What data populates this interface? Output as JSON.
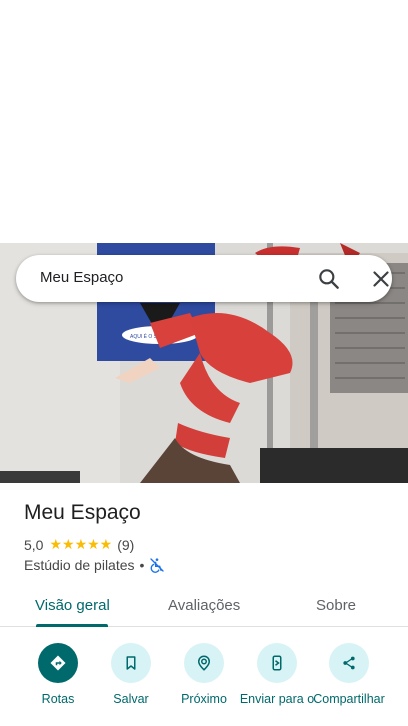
{
  "search": {
    "query": "Meu Espaço"
  },
  "place": {
    "title": "Meu Espaço",
    "rating": "5,0",
    "stars": "★★★★★",
    "reviews": "(9)",
    "category": "Estúdio de pilates",
    "separator": "•"
  },
  "tabs": [
    {
      "label": "Visão geral"
    },
    {
      "label": "Avaliações"
    },
    {
      "label": "Sobre"
    }
  ],
  "actions": [
    {
      "label": "Rotas",
      "icon": "directions-icon"
    },
    {
      "label": "Salvar",
      "icon": "bookmark-icon"
    },
    {
      "label": "Próximo",
      "icon": "nearby-icon"
    },
    {
      "label": "Enviar para o",
      "icon": "send-to-phone-icon"
    },
    {
      "label": "Compartilhar",
      "icon": "share-icon"
    }
  ],
  "photo": {
    "banner_text": "AQUI É O SEU"
  },
  "colors": {
    "accent": "#00696b",
    "accent_light": "#d8f3f5",
    "star": "#fbbc04"
  }
}
